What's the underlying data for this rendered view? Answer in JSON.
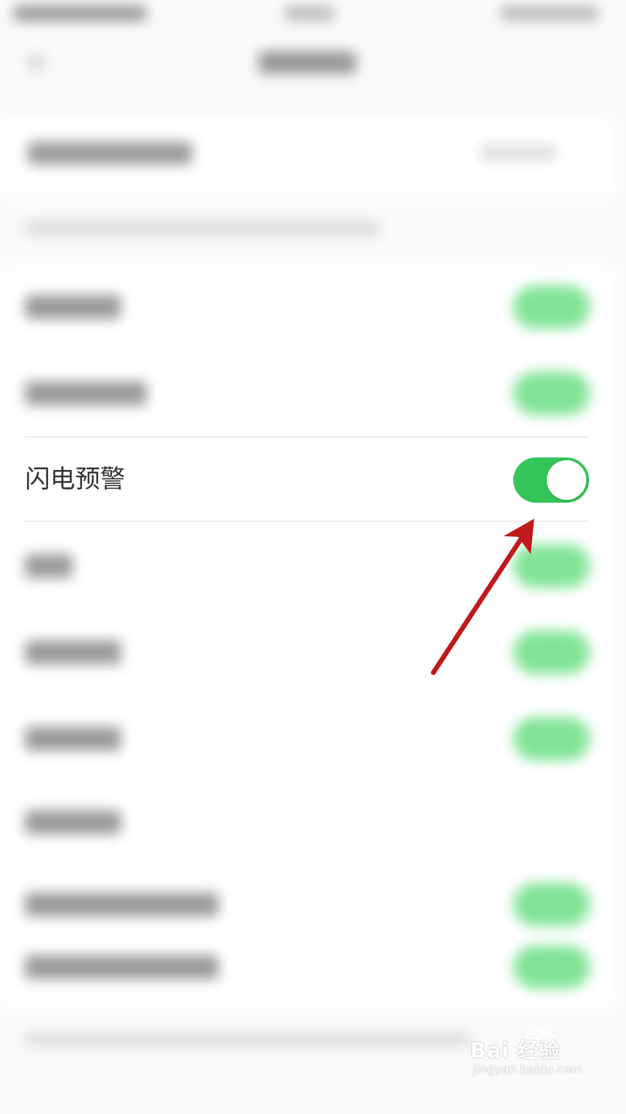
{
  "settings": {
    "lightning_alert": {
      "label": "闪电预警",
      "toggle_on": true,
      "toggle_color": "#35c65a"
    }
  },
  "annotation": {
    "arrow_color": "#c0191b"
  },
  "watermark": {
    "main": "Bai  经验",
    "sub": "jingyan.baidu.com"
  }
}
